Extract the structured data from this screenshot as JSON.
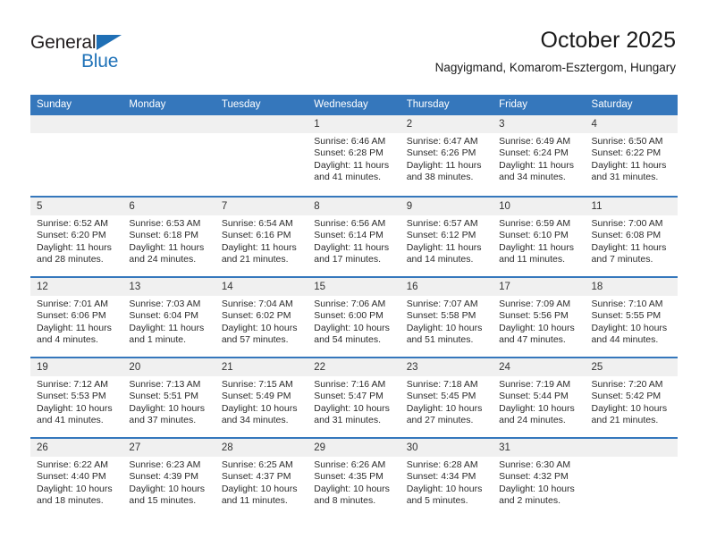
{
  "brand": {
    "name_part1": "General",
    "name_part2": "Blue",
    "accent_color": "#1f72b8"
  },
  "header": {
    "title": "October 2025",
    "subtitle": "Nagyigmand, Komarom-Esztergom, Hungary"
  },
  "theme": {
    "header_blue": "#3577bc",
    "daynum_band": "#f0f0f0",
    "text": "#2b2b2b"
  },
  "weekdays": [
    "Sunday",
    "Monday",
    "Tuesday",
    "Wednesday",
    "Thursday",
    "Friday",
    "Saturday"
  ],
  "weeks": [
    [
      {
        "day": "",
        "sunrise": "",
        "sunset": "",
        "daylight1": "",
        "daylight2": ""
      },
      {
        "day": "",
        "sunrise": "",
        "sunset": "",
        "daylight1": "",
        "daylight2": ""
      },
      {
        "day": "",
        "sunrise": "",
        "sunset": "",
        "daylight1": "",
        "daylight2": ""
      },
      {
        "day": "1",
        "sunrise": "Sunrise: 6:46 AM",
        "sunset": "Sunset: 6:28 PM",
        "daylight1": "Daylight: 11 hours",
        "daylight2": "and 41 minutes."
      },
      {
        "day": "2",
        "sunrise": "Sunrise: 6:47 AM",
        "sunset": "Sunset: 6:26 PM",
        "daylight1": "Daylight: 11 hours",
        "daylight2": "and 38 minutes."
      },
      {
        "day": "3",
        "sunrise": "Sunrise: 6:49 AM",
        "sunset": "Sunset: 6:24 PM",
        "daylight1": "Daylight: 11 hours",
        "daylight2": "and 34 minutes."
      },
      {
        "day": "4",
        "sunrise": "Sunrise: 6:50 AM",
        "sunset": "Sunset: 6:22 PM",
        "daylight1": "Daylight: 11 hours",
        "daylight2": "and 31 minutes."
      }
    ],
    [
      {
        "day": "5",
        "sunrise": "Sunrise: 6:52 AM",
        "sunset": "Sunset: 6:20 PM",
        "daylight1": "Daylight: 11 hours",
        "daylight2": "and 28 minutes."
      },
      {
        "day": "6",
        "sunrise": "Sunrise: 6:53 AM",
        "sunset": "Sunset: 6:18 PM",
        "daylight1": "Daylight: 11 hours",
        "daylight2": "and 24 minutes."
      },
      {
        "day": "7",
        "sunrise": "Sunrise: 6:54 AM",
        "sunset": "Sunset: 6:16 PM",
        "daylight1": "Daylight: 11 hours",
        "daylight2": "and 21 minutes."
      },
      {
        "day": "8",
        "sunrise": "Sunrise: 6:56 AM",
        "sunset": "Sunset: 6:14 PM",
        "daylight1": "Daylight: 11 hours",
        "daylight2": "and 17 minutes."
      },
      {
        "day": "9",
        "sunrise": "Sunrise: 6:57 AM",
        "sunset": "Sunset: 6:12 PM",
        "daylight1": "Daylight: 11 hours",
        "daylight2": "and 14 minutes."
      },
      {
        "day": "10",
        "sunrise": "Sunrise: 6:59 AM",
        "sunset": "Sunset: 6:10 PM",
        "daylight1": "Daylight: 11 hours",
        "daylight2": "and 11 minutes."
      },
      {
        "day": "11",
        "sunrise": "Sunrise: 7:00 AM",
        "sunset": "Sunset: 6:08 PM",
        "daylight1": "Daylight: 11 hours",
        "daylight2": "and 7 minutes."
      }
    ],
    [
      {
        "day": "12",
        "sunrise": "Sunrise: 7:01 AM",
        "sunset": "Sunset: 6:06 PM",
        "daylight1": "Daylight: 11 hours",
        "daylight2": "and 4 minutes."
      },
      {
        "day": "13",
        "sunrise": "Sunrise: 7:03 AM",
        "sunset": "Sunset: 6:04 PM",
        "daylight1": "Daylight: 11 hours",
        "daylight2": "and 1 minute."
      },
      {
        "day": "14",
        "sunrise": "Sunrise: 7:04 AM",
        "sunset": "Sunset: 6:02 PM",
        "daylight1": "Daylight: 10 hours",
        "daylight2": "and 57 minutes."
      },
      {
        "day": "15",
        "sunrise": "Sunrise: 7:06 AM",
        "sunset": "Sunset: 6:00 PM",
        "daylight1": "Daylight: 10 hours",
        "daylight2": "and 54 minutes."
      },
      {
        "day": "16",
        "sunrise": "Sunrise: 7:07 AM",
        "sunset": "Sunset: 5:58 PM",
        "daylight1": "Daylight: 10 hours",
        "daylight2": "and 51 minutes."
      },
      {
        "day": "17",
        "sunrise": "Sunrise: 7:09 AM",
        "sunset": "Sunset: 5:56 PM",
        "daylight1": "Daylight: 10 hours",
        "daylight2": "and 47 minutes."
      },
      {
        "day": "18",
        "sunrise": "Sunrise: 7:10 AM",
        "sunset": "Sunset: 5:55 PM",
        "daylight1": "Daylight: 10 hours",
        "daylight2": "and 44 minutes."
      }
    ],
    [
      {
        "day": "19",
        "sunrise": "Sunrise: 7:12 AM",
        "sunset": "Sunset: 5:53 PM",
        "daylight1": "Daylight: 10 hours",
        "daylight2": "and 41 minutes."
      },
      {
        "day": "20",
        "sunrise": "Sunrise: 7:13 AM",
        "sunset": "Sunset: 5:51 PM",
        "daylight1": "Daylight: 10 hours",
        "daylight2": "and 37 minutes."
      },
      {
        "day": "21",
        "sunrise": "Sunrise: 7:15 AM",
        "sunset": "Sunset: 5:49 PM",
        "daylight1": "Daylight: 10 hours",
        "daylight2": "and 34 minutes."
      },
      {
        "day": "22",
        "sunrise": "Sunrise: 7:16 AM",
        "sunset": "Sunset: 5:47 PM",
        "daylight1": "Daylight: 10 hours",
        "daylight2": "and 31 minutes."
      },
      {
        "day": "23",
        "sunrise": "Sunrise: 7:18 AM",
        "sunset": "Sunset: 5:45 PM",
        "daylight1": "Daylight: 10 hours",
        "daylight2": "and 27 minutes."
      },
      {
        "day": "24",
        "sunrise": "Sunrise: 7:19 AM",
        "sunset": "Sunset: 5:44 PM",
        "daylight1": "Daylight: 10 hours",
        "daylight2": "and 24 minutes."
      },
      {
        "day": "25",
        "sunrise": "Sunrise: 7:20 AM",
        "sunset": "Sunset: 5:42 PM",
        "daylight1": "Daylight: 10 hours",
        "daylight2": "and 21 minutes."
      }
    ],
    [
      {
        "day": "26",
        "sunrise": "Sunrise: 6:22 AM",
        "sunset": "Sunset: 4:40 PM",
        "daylight1": "Daylight: 10 hours",
        "daylight2": "and 18 minutes."
      },
      {
        "day": "27",
        "sunrise": "Sunrise: 6:23 AM",
        "sunset": "Sunset: 4:39 PM",
        "daylight1": "Daylight: 10 hours",
        "daylight2": "and 15 minutes."
      },
      {
        "day": "28",
        "sunrise": "Sunrise: 6:25 AM",
        "sunset": "Sunset: 4:37 PM",
        "daylight1": "Daylight: 10 hours",
        "daylight2": "and 11 minutes."
      },
      {
        "day": "29",
        "sunrise": "Sunrise: 6:26 AM",
        "sunset": "Sunset: 4:35 PM",
        "daylight1": "Daylight: 10 hours",
        "daylight2": "and 8 minutes."
      },
      {
        "day": "30",
        "sunrise": "Sunrise: 6:28 AM",
        "sunset": "Sunset: 4:34 PM",
        "daylight1": "Daylight: 10 hours",
        "daylight2": "and 5 minutes."
      },
      {
        "day": "31",
        "sunrise": "Sunrise: 6:30 AM",
        "sunset": "Sunset: 4:32 PM",
        "daylight1": "Daylight: 10 hours",
        "daylight2": "and 2 minutes."
      },
      {
        "day": "",
        "sunrise": "",
        "sunset": "",
        "daylight1": "",
        "daylight2": ""
      }
    ]
  ]
}
